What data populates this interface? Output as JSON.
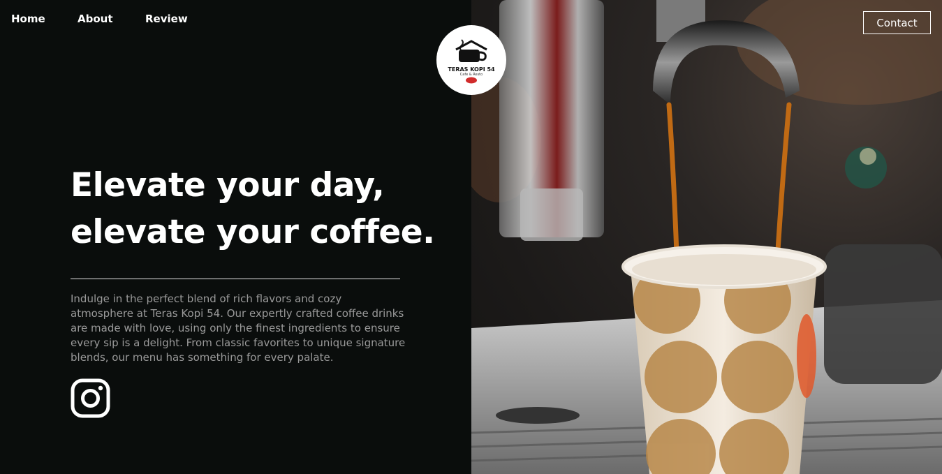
{
  "nav": {
    "home": "Home",
    "about": "About",
    "review": "Review",
    "contact": "Contact"
  },
  "logo": {
    "title": "TERAS KOPI 54",
    "sub": "Cafe & Resto"
  },
  "hero": {
    "headline_line1": "Elevate your day,",
    "headline_line2": "elevate your coffee.",
    "body": "Indulge in the perfect blend of rich flavors and cozy atmosphere at Teras Kopi 54. Our expertly crafted coffee drinks are made with love, using only the finest ingredients to ensure every sip is a delight. From classic favorites to unique signature blends, our menu has something for every palate."
  },
  "colors": {
    "background": "#0a0d0c",
    "text": "#ffffff",
    "muted": "#9a9a9a"
  },
  "icons": {
    "social": "instagram-icon"
  }
}
